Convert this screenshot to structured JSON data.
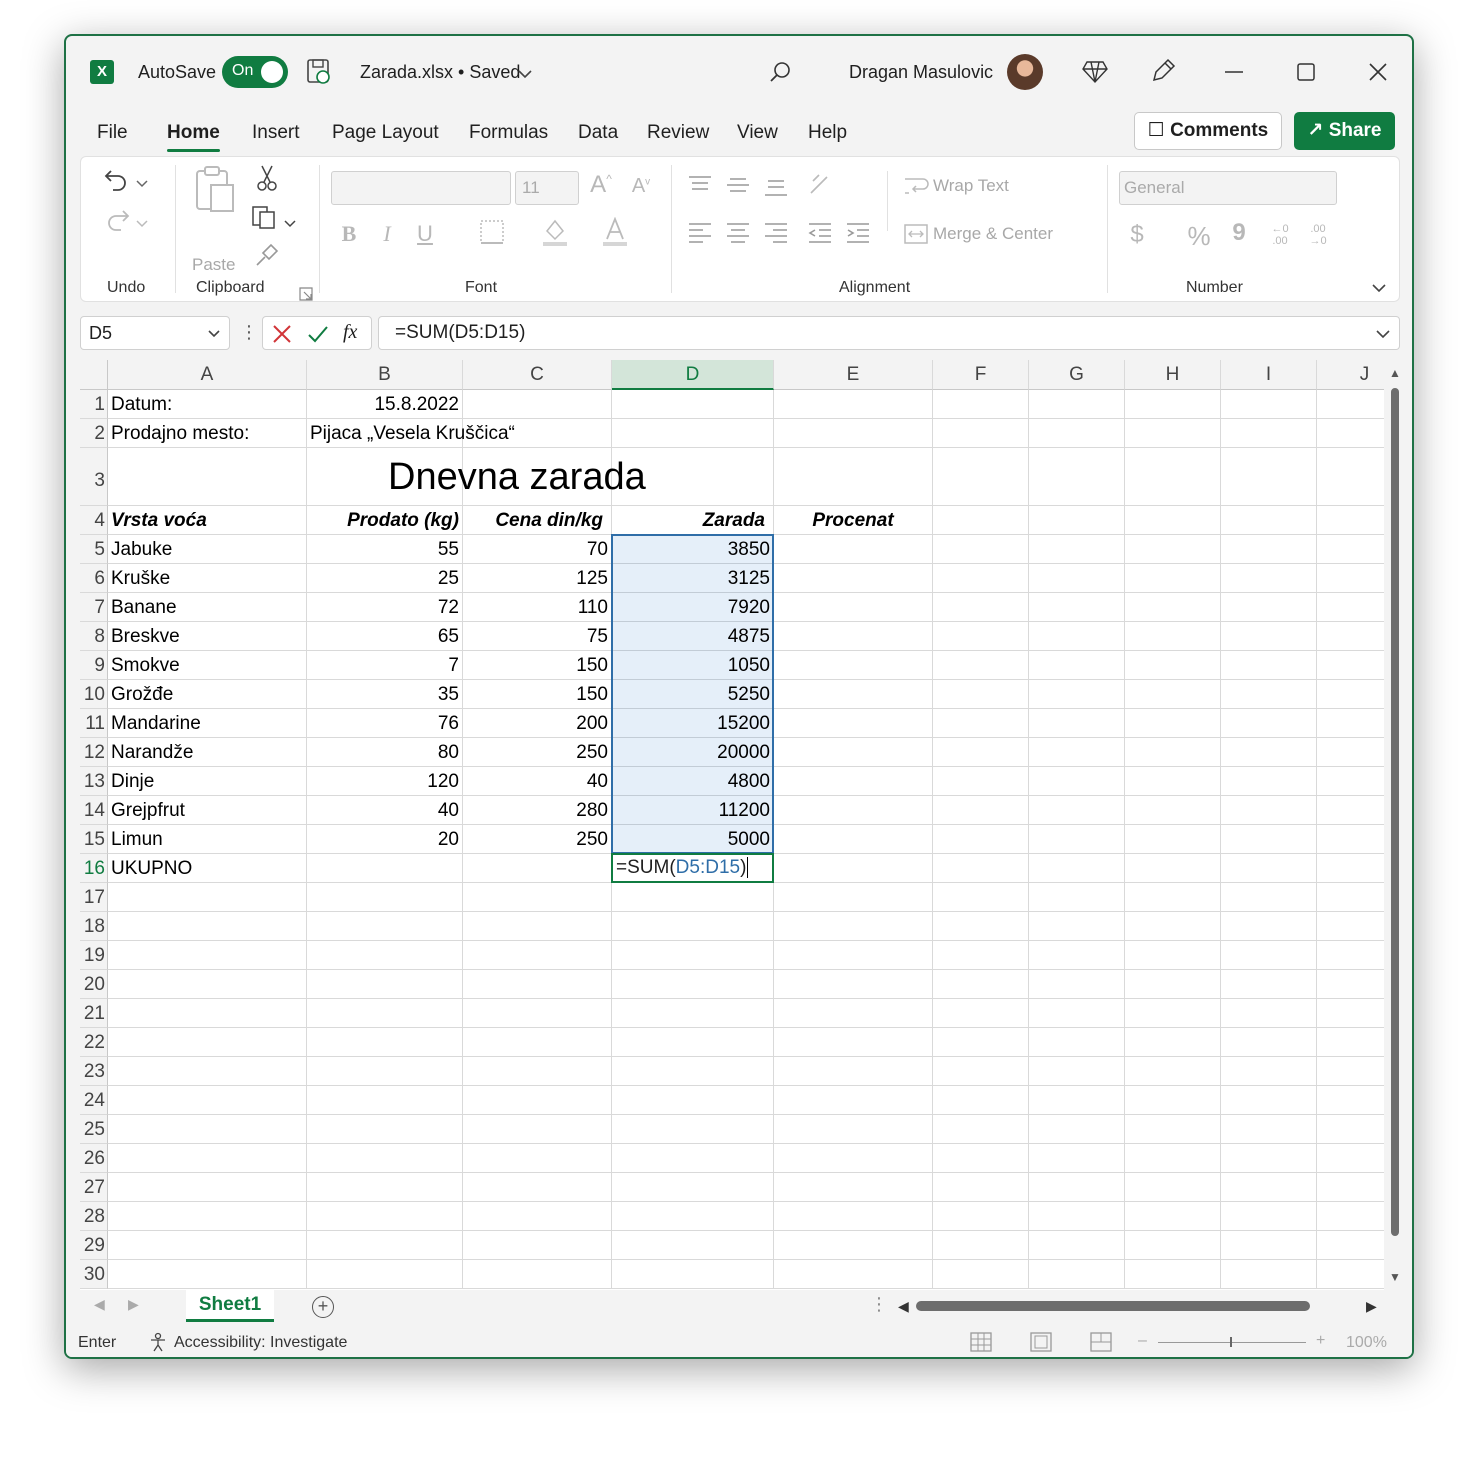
{
  "titlebar": {
    "app_icon": "excel-icon",
    "autosave_label": "AutoSave",
    "autosave_state": "On",
    "filename": "Zarada.xlsx • Saved",
    "user_name": "Dragan Masulovic"
  },
  "menu": {
    "items": [
      "File",
      "Home",
      "Insert",
      "Page Layout",
      "Formulas",
      "Data",
      "Review",
      "View",
      "Help"
    ],
    "active": "Home",
    "comments_label": "Comments",
    "share_label": "Share"
  },
  "ribbon": {
    "groups": [
      "Undo",
      "Clipboard",
      "Font",
      "Alignment",
      "Number"
    ],
    "paste_label": "Paste",
    "font_size": "11",
    "wrap_text_label": "Wrap Text",
    "merge_center_label": "Merge & Center",
    "number_format": "General",
    "bold": "B",
    "italic": "I",
    "underline": "U",
    "currency": "$",
    "percent": "%",
    "comma": "9",
    "inc_decimal": "←0 .00",
    "dec_decimal": ".00 →0"
  },
  "formula_bar": {
    "name_box": "D5",
    "formula": "=SUM(D5:D15)",
    "fx": "fx"
  },
  "sheet": {
    "columns": [
      "A",
      "B",
      "C",
      "D",
      "E",
      "F",
      "G",
      "H",
      "I",
      "J"
    ],
    "selected_column": "D",
    "rows": [
      "1",
      "2",
      "3",
      "4",
      "5",
      "6",
      "7",
      "8",
      "9",
      "10",
      "11",
      "12",
      "13",
      "14",
      "15",
      "16",
      "17",
      "18",
      "19",
      "20",
      "21",
      "22",
      "23",
      "24",
      "25",
      "26",
      "27",
      "28",
      "29",
      "30"
    ],
    "datum_label": "Datum:",
    "datum_value": "15.8.2022",
    "prodajno_label": "Prodajno mesto:",
    "prodajno_value": "Pijaca „Vesela Kruščica“",
    "title": "Dnevna zarada",
    "headers": [
      "Vrsta voća",
      "Prodato (kg)",
      "Cena din/kg",
      "Zarada",
      "Procenat"
    ],
    "data": [
      [
        "Jabuke",
        "55",
        "70",
        "3850"
      ],
      [
        "Kruške",
        "25",
        "125",
        "3125"
      ],
      [
        "Banane",
        "72",
        "110",
        "7920"
      ],
      [
        "Breskve",
        "65",
        "75",
        "4875"
      ],
      [
        "Smokve",
        "7",
        "150",
        "1050"
      ],
      [
        "Grožđe",
        "35",
        "150",
        "5250"
      ],
      [
        "Mandarine",
        "76",
        "200",
        "15200"
      ],
      [
        "Narandže",
        "80",
        "250",
        "20000"
      ],
      [
        "Dinje",
        "120",
        "40",
        "4800"
      ],
      [
        "Grejpfrut",
        "40",
        "280",
        "11200"
      ],
      [
        "Limun",
        "20",
        "250",
        "5000"
      ]
    ],
    "total_label": "UKUPNO",
    "edit_prefix": "=SUM(",
    "edit_range": "D5:D15",
    "edit_suffix": ")"
  },
  "tabs": {
    "sheet_name": "Sheet1"
  },
  "status": {
    "mode": "Enter",
    "accessibility": "Accessibility: Investigate",
    "zoom": "100%"
  },
  "colors": {
    "accent": "#107c41",
    "selection_border": "#2f6ea8",
    "range_ref": "#2f6ea8"
  }
}
